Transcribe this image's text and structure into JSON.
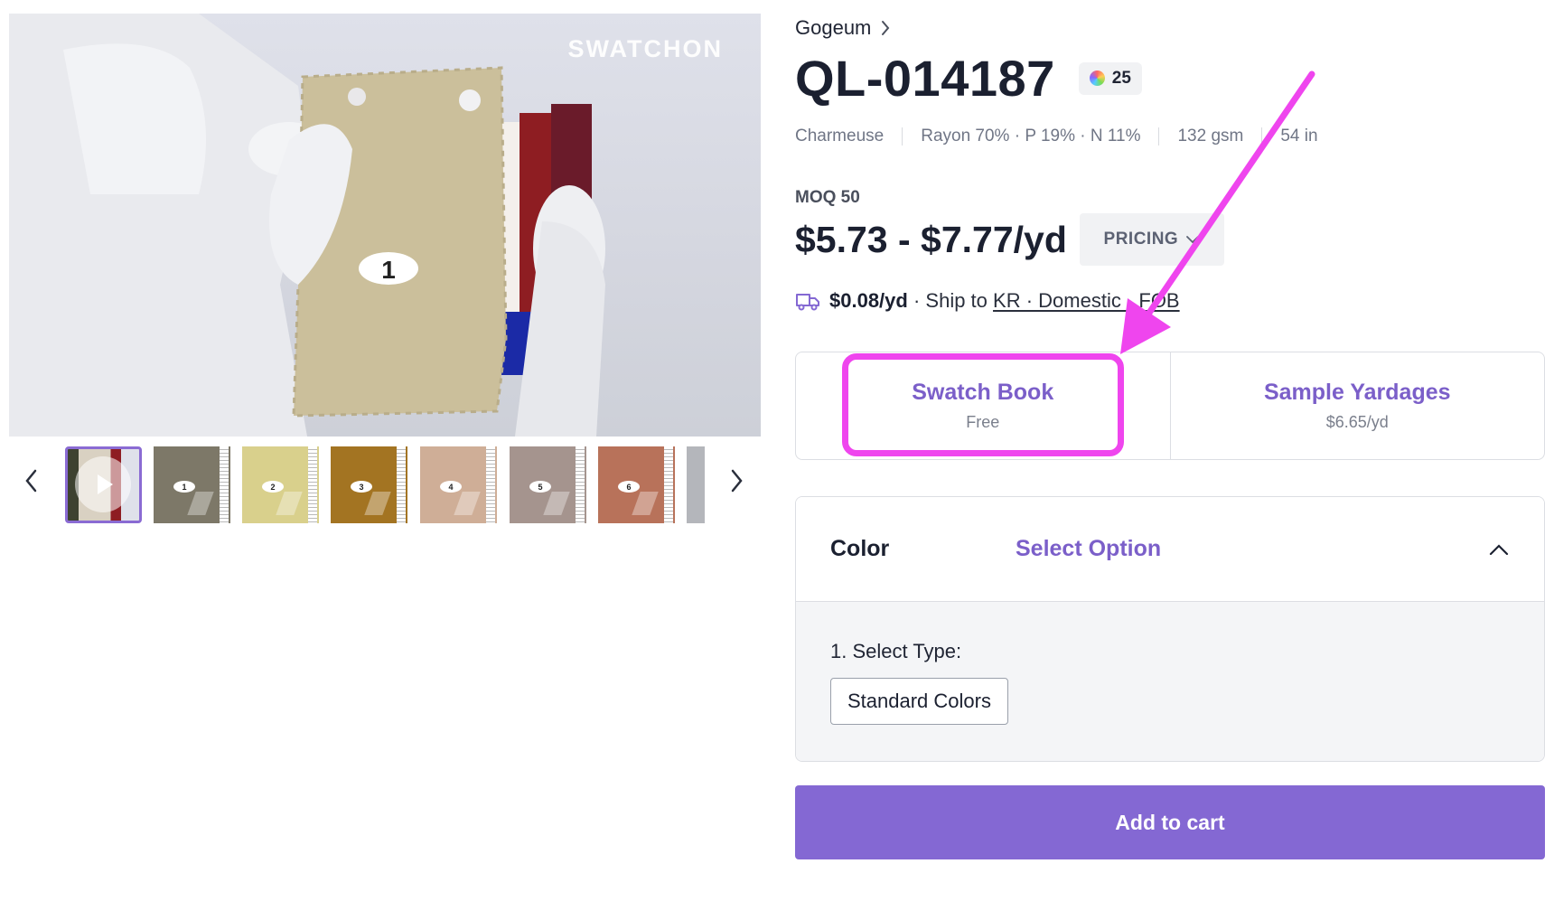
{
  "gallery": {
    "watermark": "SWATCHON",
    "prev_icon": "chevron-left-icon",
    "next_icon": "chevron-right-icon",
    "main_swatch_number": "1",
    "thumbnails": [
      {
        "kind": "video",
        "color": "#b9b3a8",
        "number": ""
      },
      {
        "kind": "swatch",
        "color": "#7d7868",
        "number": "1"
      },
      {
        "kind": "swatch",
        "color": "#d9d08c",
        "number": "2"
      },
      {
        "kind": "swatch",
        "color": "#a37422",
        "number": "3"
      },
      {
        "kind": "swatch",
        "color": "#cfae97",
        "number": "4"
      },
      {
        "kind": "swatch",
        "color": "#a5948e",
        "number": "5"
      },
      {
        "kind": "swatch",
        "color": "#b8725a",
        "number": "6"
      },
      {
        "kind": "swatch",
        "color": "#b4b6bb",
        "number": ""
      }
    ]
  },
  "product": {
    "breadcrumb": "Gogeum",
    "code": "QL-014187",
    "color_count": "25",
    "specs": [
      "Charmeuse",
      "Rayon 70% · P 19% · N 11%",
      "132 gsm",
      "54 in"
    ],
    "moq": "MOQ 50",
    "price": "$5.73 - $7.77/yd",
    "pricing_label": "PRICING",
    "shipping": {
      "price": "$0.08/yd",
      "text": "· Ship to",
      "link": "KR · Domestic · FOB"
    }
  },
  "options": [
    {
      "title": "Swatch Book",
      "sub": "Free"
    },
    {
      "title": "Sample Yardages",
      "sub": "$6.65/yd"
    }
  ],
  "color_panel": {
    "label": "Color",
    "select": "Select Option",
    "type_label": "1. Select Type:",
    "type_button": "Standard Colors"
  },
  "cart_label": "Add to cart",
  "colors": {
    "accent": "#8468d3",
    "accent_text": "#7b5fc9",
    "annotation": "#ef45ee"
  }
}
